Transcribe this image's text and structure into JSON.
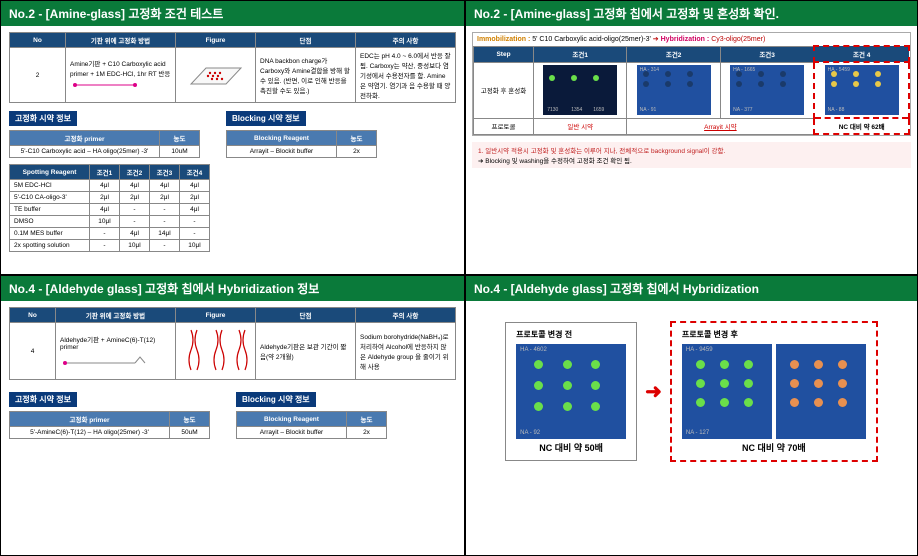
{
  "panels": {
    "tl": {
      "title": "No.2 - [Amine-glass] 고정화 조건 테스트",
      "method_hdr": [
        "No",
        "기판 위에 고정화 방법",
        "Figure",
        "단점",
        "주의 사항"
      ],
      "method_row": {
        "no": "2",
        "desc": "Amine기판 + C10 Carboxylic acid primer + 1M EDC-HCl, 1hr RT 반응",
        "cons": "DNA backbon charge가 Carboxy와 Amine결합을 방해 할 수 있음. (반면, 이로 인해 반응을 촉진할 수도 있음.)",
        "caution": "EDC는 pH 4.0 ~ 6.0에서 반응 잘 됨. Carboxy는 약산, 중성보다 염기성에서 수용전자를 함. Amine은 약염기. 염기과 음 수용할 때 양전하화."
      },
      "primer_section": "고정화 시약 정보",
      "primer_hdr": [
        "고정화 primer",
        "농도"
      ],
      "primer_row": [
        "5'-C10 Carboxylic acid – HA oligo(25mer) -3'",
        "10uM"
      ],
      "blocking_section": "Blocking 시약 정보",
      "blocking_hdr": [
        "Blocking Reagent",
        "농도"
      ],
      "blocking_row": [
        "Arrayit – Blockit buffer",
        "2x"
      ],
      "spot_title": "Spotting Reagent",
      "spot_cond": [
        "조건1",
        "조건2",
        "조건3",
        "조건4"
      ],
      "spot_rows": [
        [
          "5M EDC-HCl",
          "4μl",
          "4μl",
          "4μl",
          "4μl"
        ],
        [
          "5'-C10 CA-oligo-3'",
          "2μl",
          "2μl",
          "2μl",
          "2μl"
        ],
        [
          "TE buffer",
          "4μl",
          "-",
          "-",
          "4μl"
        ],
        [
          "DMSO",
          "10μl",
          "-",
          "-",
          "-"
        ],
        [
          "0.1M MES buffer",
          "-",
          "4μl",
          "14μl",
          "-"
        ],
        [
          "2x spotting solution",
          "-",
          "10μl",
          "-",
          "10μl"
        ]
      ]
    },
    "tr": {
      "title": "No.2 - [Amine-glass] 고정화 칩에서 고정화 및 혼성화 확인.",
      "line": {
        "im": "Immobilization :",
        "im_v": "5' C10 Carboxylic acid-oligo(25mer)-3'",
        "arrow": "➔",
        "hy": "Hybridization :",
        "hy_v": "Cy3-oligo(25mer)"
      },
      "tbl_hdr": [
        "Step",
        "조건1",
        "조건2",
        "조건3",
        "조건 4"
      ],
      "step_label": "고정화 후 혼성화",
      "chip_labels": {
        "c1": [
          "7130",
          "1354",
          "1659"
        ],
        "c2": [
          "HA - 314",
          "NA - 91"
        ],
        "c3": [
          "HA - 1665",
          "NA - 377"
        ],
        "c4": [
          "HA - 5459",
          "NA - 88"
        ]
      },
      "row2": [
        "프로토콜",
        "일반 시약",
        "Arrayit 시약"
      ],
      "nc_text": "NC 대비 약 62배",
      "note1": "1. 일반시약 적용시 고정화 및 혼성화는 이루어 지나, 전체적으로 background signal이 강함.",
      "note2": "➔ Blocking 및 washing을 수정하여 고정화 조건 확인 됨."
    },
    "bl": {
      "title": "No.4 - [Aldehyde glass] 고정화 칩에서 Hybridization 정보",
      "method_hdr": [
        "No",
        "기판 위에 고정화 방법",
        "Figure",
        "단점",
        "주의 사항"
      ],
      "method_row": {
        "no": "4",
        "desc": "Aldehyde기판 + AmineC(6)-T(12) primer",
        "cons": "Aldehyde기판은 보관 기간이 짧음(약 2개월)",
        "caution": "Sodium borohydride(NaBH₄)로 처리하여 Alcohol에 반응하지 않은 Aldehyde group 을 줄이기 위해 사용"
      },
      "primer_section": "고정화 시약 정보",
      "primer_hdr": [
        "고정화 primer",
        "농도"
      ],
      "primer_row": [
        "5'-AmineC(6)-T(12) – HA oligo(25mer) -3'",
        "50uM"
      ],
      "blocking_section": "Blocking 시약 정보",
      "blocking_hdr": [
        "Blocking Reagent",
        "농도"
      ],
      "blocking_row": [
        "Arrayit – Blockit buffer",
        "2x"
      ]
    },
    "br": {
      "title": "No.4 - [Aldehyde glass] 고정화 칩에서 Hybridization",
      "before_label": "프로토콜 변경 전",
      "after_label": "프로토콜 변경 후",
      "before_chip": [
        "HA - 4602",
        "NA - 92"
      ],
      "after_chip": [
        "HA - 9459",
        "NA - 127"
      ],
      "before_cap": "NC 대비 약 50배",
      "after_cap": "NC 대비 약 70배"
    }
  }
}
